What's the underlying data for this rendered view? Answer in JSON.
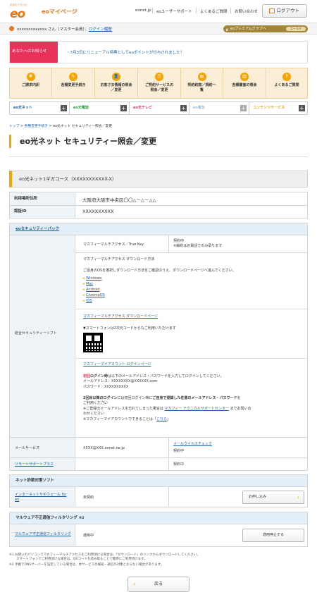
{
  "header": {
    "logo_sub": "あなたともっと",
    "logo": "eo",
    "mypage": "eoマイページ",
    "nav": [
      "eonet.jp",
      "eoユーザーサポート",
      "よくあるご質問",
      "お問い合わせ"
    ],
    "logout": "ログアウト"
  },
  "userbar": {
    "user": "xxxxxxxxxxxxx さん（マスター会員）：",
    "history": "ログイン履歴",
    "premium": "eoプレミアムクラブへ",
    "rank": "ゴールド"
  },
  "notice": {
    "label": "あなたへのお知らせ",
    "message": "・7月3日にリニューアル特典としてeoポイントが付与されました！"
  },
  "menu": [
    {
      "label": "ご請求内訳",
      "icon": "¥"
    },
    {
      "label": "各種変更手続き",
      "icon": "✎"
    },
    {
      "label": "お客さま情報の照会\n／変更",
      "icon": "👤"
    },
    {
      "label": "ご契約サービスの\n照会／変更",
      "icon": "☰"
    },
    {
      "label": "契約約款／規約一\n覧",
      "icon": "▤"
    },
    {
      "label": "各種書面の照会",
      "icon": "▥"
    },
    {
      "label": "よくあるご質問",
      "icon": "?"
    }
  ],
  "services": [
    {
      "label": "eo光ネット",
      "color": "#1a5ca8"
    },
    {
      "label": "eo光電話",
      "color": "#2a9d3a"
    },
    {
      "label": "eo光テレビ",
      "color": "#e8325a"
    },
    {
      "label": "eo電気",
      "color": "#9fbfd9"
    },
    {
      "label": "コンテンツサービス",
      "color": "#f5a300"
    }
  ],
  "breadcrumb": [
    "トップ",
    "各種変更手続き",
    "eo光ネット セキュリティー照会／変更"
  ],
  "page_title": "eo光ネット セキュリティー照会／変更",
  "course": "eo光ネット1ギガコース（XXXXXXXXXXX-X）",
  "address": {
    "label": "利用場所住所",
    "value": "大阪府大阪市中央区〇〇△－△－△△"
  },
  "auth": {
    "label": "認証ID",
    "value": "XXXXXXXXXX"
  },
  "security_pack": "eoセキュリティーパック",
  "sougou": {
    "label": "総合セキュリティーソフト",
    "product": "マカフィーマルチアクセス／True Key",
    "status": "契約中",
    "note": "※解約はお電話でのみ承ります",
    "dl_title": "マカフィーマルチアクセス ダウンロード方法",
    "dl_desc": "ご自身のOSを選択しダウンロード方法をご確認のうえ、ダウンロードページへ進んでください。",
    "os": [
      "Windows",
      "Mac",
      "Android",
      "ChromeOS",
      "iOS"
    ],
    "dl_link": "マカフィーマルチアクセス ダウンロードページ",
    "qr_note": "▼スマートフォンは2次元コードからもご利用いただけます",
    "account_link": "マカフィーマイアカウント ログインページ",
    "first_a": "初回",
    "first_b": "ログイン時",
    "first_c": "は以下のメールアドレス・パスワードを入力してログインしてください。",
    "mail": "メールアドレス：XXXXXXXX@XXXXXX.com",
    "pass": "パスワード：XXXXXXXXXX",
    "second_a": "2回目以降のログイン",
    "second_b": "には初回ログイン時に",
    "second_c": "ご自身で登録した任意のメールアドレス・パスワード",
    "second_d": "を",
    "second_e": "ご利用ください",
    "forgot_a": "※ご登録のメールアドレスを忘れてしまった場合は",
    "forgot_link": "マカフィー テクニカルサポートセンター",
    "forgot_b": "までお問い合",
    "forgot_c": "わせください",
    "can_a": "※マカフィーマイアカウントでできることは「",
    "can_link": "こちら",
    "can_b": "」"
  },
  "mail": {
    "label": "メールサービス",
    "address": "XXXX@XXX.eonet.ne.jp",
    "check": "メールウイルスチェック",
    "status": "契約中"
  },
  "remote": {
    "label": "リモートサポートプラス",
    "status": "契約中"
  },
  "fraud": {
    "title": "ネット詐欺対策ソフト",
    "label": "インターネットサギウォール for eo",
    "status": "未契約",
    "button": "お申し込み"
  },
  "malware": {
    "title": "マルウェア不正通信フィルタリング",
    "note": "※2",
    "label": "マルウェア不正通信フィルタリング",
    "status": "適用中",
    "button": "適用停止する"
  },
  "footnotes": [
    "※1 お使いのパソコンでマカフィーマルチアクセスをご利用頂ける場合は、「ダウンロード」のリンクからダウンロードしてください。",
    "スマートフォンでご利用頂ける場合は、QRコードを読み取ることで簡単にご利用頂けます。",
    "※2 手動でDNSサーバーを設定している場合は、本サービスの検知・通信の対象とならない場合があります。"
  ],
  "back": "戻る"
}
